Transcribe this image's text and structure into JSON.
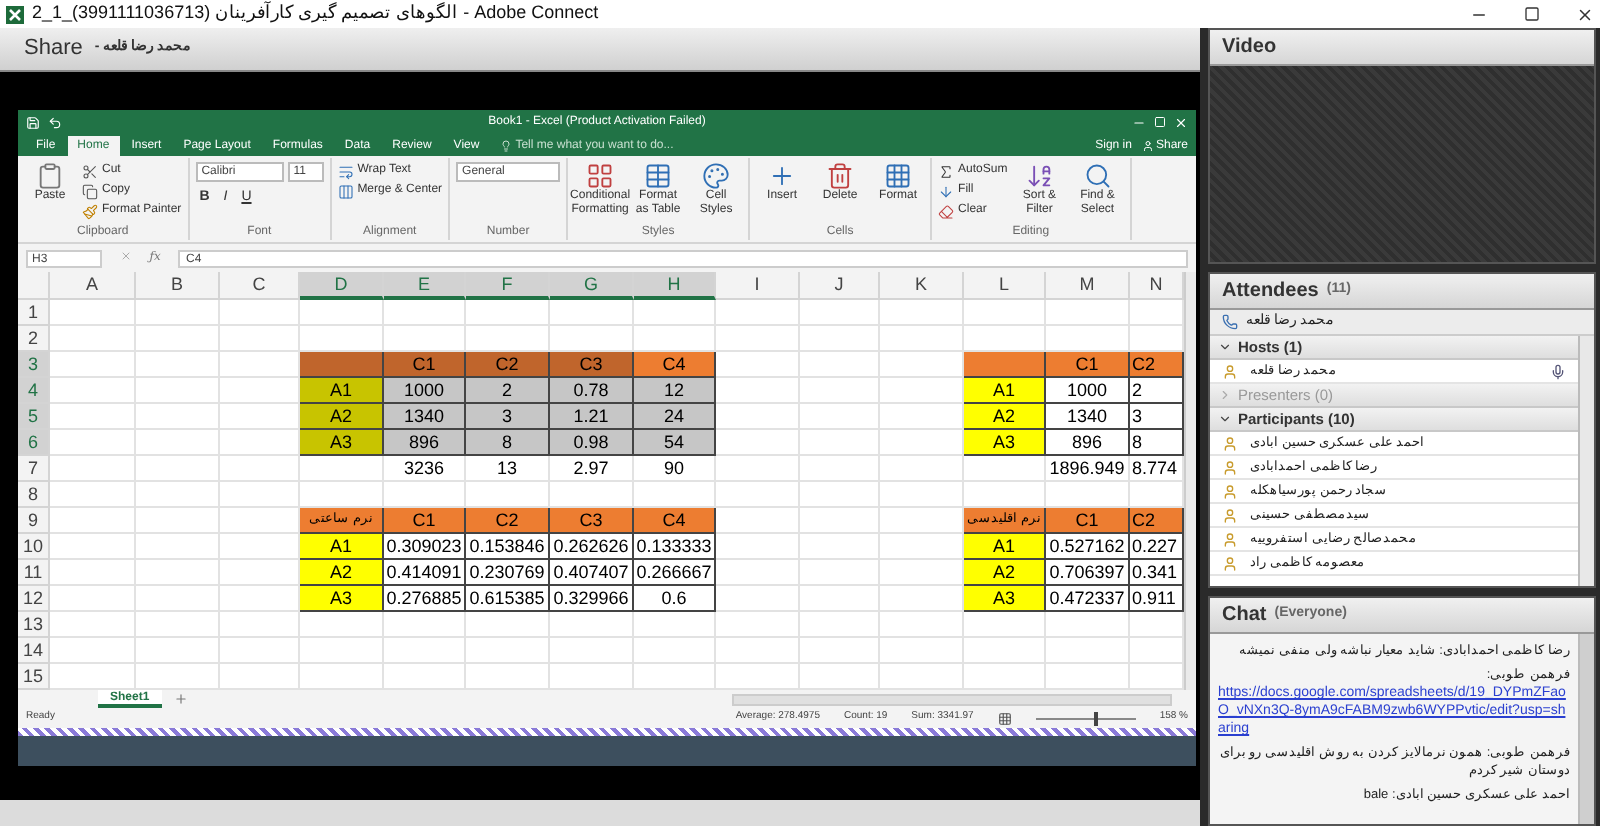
{
  "window": {
    "title": "2_1_(3991111036713) الگوهای تصمیم گیری کارآفرینان - Adobe Connect"
  },
  "share": {
    "title": "Share",
    "presenter": "- محمد رضا قلعه"
  },
  "excel": {
    "title": "Book1 - Excel (Product Activation Failed)",
    "sign_in": "Sign in",
    "share": "Share",
    "tell_me": "Tell me what you want to do...",
    "tabs": [
      {
        "label": "File",
        "selected": false
      },
      {
        "label": "Home",
        "selected": true
      },
      {
        "label": "Insert",
        "selected": false
      },
      {
        "label": "Page Layout",
        "selected": false
      },
      {
        "label": "Formulas",
        "selected": false
      },
      {
        "label": "Data",
        "selected": false
      },
      {
        "label": "Review",
        "selected": false
      },
      {
        "label": "View",
        "selected": false
      }
    ],
    "groups": [
      {
        "label": "Clipboard",
        "large": [
          {
            "kind": "paste",
            "label": "Paste"
          }
        ],
        "small": [
          {
            "kind": "cut",
            "label": "Cut"
          },
          {
            "kind": "copy",
            "label": "Copy"
          },
          {
            "kind": "painter",
            "label": "Format Painter"
          }
        ]
      },
      {
        "label": "Font",
        "font": "Calibri",
        "size": "11",
        "format": [
          "B",
          "I",
          "U"
        ]
      },
      {
        "label": "Alignment",
        "small": [
          {
            "kind": "wrap",
            "label": "Wrap Text"
          },
          {
            "kind": "merge",
            "label": "Merge & Center"
          }
        ]
      },
      {
        "label": "Number",
        "number_format": "General"
      },
      {
        "label": "Styles",
        "large": [
          {
            "kind": "conditional",
            "label": "Conditional Formatting"
          },
          {
            "kind": "table",
            "label": "Format as Table"
          },
          {
            "kind": "styles",
            "label": "Cell Styles"
          }
        ]
      },
      {
        "label": "Cells",
        "large": [
          {
            "kind": "insert",
            "label": "Insert"
          },
          {
            "kind": "delete",
            "label": "Delete"
          },
          {
            "kind": "format",
            "label": "Format"
          }
        ]
      },
      {
        "label": "Editing",
        "small": [
          {
            "kind": "sum",
            "label": "AutoSum"
          },
          {
            "kind": "fill",
            "label": "Fill"
          },
          {
            "kind": "clear",
            "label": "Clear"
          }
        ],
        "large": [
          {
            "kind": "sort",
            "label": "Sort & Filter"
          },
          {
            "kind": "find",
            "label": "Find & Select"
          }
        ]
      }
    ],
    "name_box": "H3",
    "function_label": "ƒx",
    "formula": "C4",
    "columns": [
      {
        "label": "A",
        "selected": false
      },
      {
        "label": "B",
        "selected": false
      },
      {
        "label": "C",
        "selected": false
      },
      {
        "label": "D",
        "selected": true
      },
      {
        "label": "E",
        "selected": true
      },
      {
        "label": "F",
        "selected": true
      },
      {
        "label": "G",
        "selected": true
      },
      {
        "label": "H",
        "selected": true
      },
      {
        "label": "I",
        "selected": false
      },
      {
        "label": "J",
        "selected": false
      },
      {
        "label": "K",
        "selected": false
      },
      {
        "label": "L",
        "selected": false
      },
      {
        "label": "M",
        "selected": false
      },
      {
        "label": "N",
        "selected": false
      }
    ],
    "rows": [
      {
        "number": "1",
        "selected": false
      },
      {
        "number": "2",
        "selected": false
      },
      {
        "number": "3",
        "selected": true,
        "cells": [
          {
            "selected": false
          },
          {
            "selected": false
          },
          {
            "selected": false
          },
          {
            "kind": "header",
            "selected": true
          },
          {
            "text": "C1",
            "kind": "header",
            "selected": true
          },
          {
            "text": "C2",
            "kind": "header",
            "selected": true
          },
          {
            "text": "C3",
            "kind": "header",
            "selected": true
          },
          {
            "text": "C4",
            "kind": "header",
            "selected": false
          },
          {
            "selected": false
          },
          {
            "selected": false
          },
          {
            "selected": false
          },
          {
            "kind": "header",
            "selected": false
          },
          {
            "text": "C1",
            "kind": "header",
            "selected": false
          },
          {
            "text": "C2",
            "kind": "header",
            "selected": false
          }
        ]
      },
      {
        "number": "4",
        "selected": true,
        "cells": [
          {
            "selected": false
          },
          {
            "selected": false
          },
          {
            "selected": false
          },
          {
            "text": "A1",
            "kind": "label",
            "selected": true
          },
          {
            "text": "1000",
            "kind": "value",
            "selected": true
          },
          {
            "text": "2",
            "kind": "value",
            "selected": true
          },
          {
            "text": "0.78",
            "kind": "value",
            "selected": true
          },
          {
            "text": "12",
            "kind": "value",
            "selected": true
          },
          {
            "selected": false
          },
          {
            "selected": false
          },
          {
            "selected": false
          },
          {
            "text": "A1",
            "kind": "label",
            "selected": false
          },
          {
            "text": "1000",
            "kind": "value",
            "selected": false
          },
          {
            "text": "2",
            "kind": "value",
            "selected": false
          }
        ]
      },
      {
        "number": "5",
        "selected": true,
        "cells": [
          {
            "selected": false
          },
          {
            "selected": false
          },
          {
            "selected": false
          },
          {
            "text": "A2",
            "kind": "label",
            "selected": true
          },
          {
            "text": "1340",
            "kind": "value",
            "selected": true
          },
          {
            "text": "3",
            "kind": "value",
            "selected": true
          },
          {
            "text": "1.21",
            "kind": "value",
            "selected": true
          },
          {
            "text": "24",
            "kind": "value",
            "selected": true
          },
          {
            "selected": false
          },
          {
            "selected": false
          },
          {
            "selected": false
          },
          {
            "text": "A2",
            "kind": "label",
            "selected": false
          },
          {
            "text": "1340",
            "kind": "value",
            "selected": false
          },
          {
            "text": "3",
            "kind": "value",
            "selected": false
          }
        ]
      },
      {
        "number": "6",
        "selected": true,
        "cells": [
          {
            "selected": false
          },
          {
            "selected": false
          },
          {
            "selected": false
          },
          {
            "text": "A3",
            "kind": "label",
            "selected": true
          },
          {
            "text": "896",
            "kind": "value",
            "selected": true
          },
          {
            "text": "8",
            "kind": "value",
            "selected": true
          },
          {
            "text": "0.98",
            "kind": "value",
            "selected": true
          },
          {
            "text": "54",
            "kind": "value",
            "selected": true
          },
          {
            "selected": false
          },
          {
            "selected": false
          },
          {
            "selected": false
          },
          {
            "text": "A3",
            "kind": "label",
            "selected": false
          },
          {
            "text": "896",
            "kind": "value",
            "selected": false
          },
          {
            "text": "8",
            "kind": "value",
            "selected": false
          }
        ]
      },
      {
        "number": "7",
        "selected": false,
        "cells": [
          {
            "selected": false
          },
          {
            "selected": false
          },
          {
            "selected": false
          },
          {
            "selected": false
          },
          {
            "text": "3236",
            "selected": false
          },
          {
            "text": "13",
            "selected": false
          },
          {
            "text": "2.97",
            "selected": false
          },
          {
            "text": "90",
            "selected": false
          },
          {
            "selected": false
          },
          {
            "selected": false
          },
          {
            "selected": false
          },
          {
            "selected": false
          },
          {
            "text": "1896.949",
            "selected": false
          },
          {
            "text": "8.774",
            "selected": false
          }
        ]
      },
      {
        "number": "8",
        "selected": false
      },
      {
        "number": "9",
        "selected": false,
        "cells": [
          {
            "selected": false
          },
          {
            "selected": false
          },
          {
            "selected": false
          },
          {
            "text": "نرم ساعتی",
            "kind": "header",
            "selected": false
          },
          {
            "text": "C1",
            "kind": "header",
            "selected": false
          },
          {
            "text": "C2",
            "kind": "header",
            "selected": false
          },
          {
            "text": "C3",
            "kind": "header",
            "selected": false
          },
          {
            "text": "C4",
            "kind": "header",
            "selected": false
          },
          {
            "selected": false
          },
          {
            "selected": false
          },
          {
            "selected": false
          },
          {
            "text": "نرم اقلیدسی",
            "kind": "header",
            "selected": false
          },
          {
            "text": "C1",
            "kind": "header",
            "selected": false
          },
          {
            "text": "C2",
            "kind": "header",
            "selected": false
          }
        ]
      },
      {
        "number": "10",
        "selected": false,
        "cells": [
          {
            "selected": false
          },
          {
            "selected": false
          },
          {
            "selected": false
          },
          {
            "text": "A1",
            "kind": "label",
            "selected": false
          },
          {
            "text": "0.309023",
            "kind": "value",
            "selected": false
          },
          {
            "text": "0.153846",
            "kind": "value",
            "selected": false
          },
          {
            "text": "0.262626",
            "kind": "value",
            "selected": false
          },
          {
            "text": "0.133333",
            "kind": "value",
            "selected": false
          },
          {
            "selected": false
          },
          {
            "selected": false
          },
          {
            "selected": false
          },
          {
            "text": "A1",
            "kind": "label",
            "selected": false
          },
          {
            "text": "0.527162",
            "kind": "value",
            "selected": false
          },
          {
            "text": "0.227",
            "kind": "value",
            "selected": false
          }
        ]
      },
      {
        "number": "11",
        "selected": false,
        "cells": [
          {
            "selected": false
          },
          {
            "selected": false
          },
          {
            "selected": false
          },
          {
            "text": "A2",
            "kind": "label",
            "selected": false
          },
          {
            "text": "0.414091",
            "kind": "value",
            "selected": false
          },
          {
            "text": "0.230769",
            "kind": "value",
            "selected": false
          },
          {
            "text": "0.407407",
            "kind": "value",
            "selected": false
          },
          {
            "text": "0.266667",
            "kind": "value",
            "selected": false
          },
          {
            "selected": false
          },
          {
            "selected": false
          },
          {
            "selected": false
          },
          {
            "text": "A2",
            "kind": "label",
            "selected": false
          },
          {
            "text": "0.706397",
            "kind": "value",
            "selected": false
          },
          {
            "text": "0.341",
            "kind": "value",
            "selected": false
          }
        ]
      },
      {
        "number": "12",
        "selected": false,
        "cells": [
          {
            "selected": false
          },
          {
            "selected": false
          },
          {
            "selected": false
          },
          {
            "text": "A3",
            "kind": "label",
            "selected": false
          },
          {
            "text": "0.276885",
            "kind": "value",
            "selected": false
          },
          {
            "text": "0.615385",
            "kind": "value",
            "selected": false
          },
          {
            "text": "0.329966",
            "kind": "value",
            "selected": false
          },
          {
            "text": "0.6",
            "kind": "value",
            "selected": false
          },
          {
            "selected": false
          },
          {
            "selected": false
          },
          {
            "selected": false
          },
          {
            "text": "A3",
            "kind": "label",
            "selected": false
          },
          {
            "text": "0.472337",
            "kind": "value",
            "selected": false
          },
          {
            "text": "0.911",
            "kind": "value",
            "selected": false
          }
        ]
      },
      {
        "number": "13",
        "selected": false
      },
      {
        "number": "14",
        "selected": false
      },
      {
        "number": "15",
        "selected": false
      }
    ],
    "sheets": [
      {
        "label": "Sheet1",
        "selected": true
      }
    ],
    "status": {
      "state": "Ready",
      "average": "Average: 278.4975",
      "count": "Count: 19",
      "sum": "Sum: 3341.97",
      "zoom": "158 %",
      "zoom_slider": {
        "level": 0.6
      }
    }
  },
  "video": {
    "title": "Video"
  },
  "attendees": {
    "title": "Attendees",
    "count": "(11)",
    "speaker": "محمد رضا قلعه",
    "sections": [
      {
        "label": "Hosts (1)",
        "expanded": true,
        "people": [
          {
            "name": "محمد رضا قلعه",
            "mic": true
          }
        ]
      },
      {
        "label": "Presenters (0)",
        "expanded": false
      },
      {
        "label": "Participants (10)",
        "expanded": true,
        "people": [
          {
            "name": "احمد علی عسکری حسین ابادی",
            "mic": false
          },
          {
            "name": "رضا کاظمی احمدابادی",
            "mic": false
          },
          {
            "name": "سجاد رحمن پورسیاهکله",
            "mic": false
          },
          {
            "name": "سیدمصطفی حسینی",
            "mic": false
          },
          {
            "name": "محمدصالح رضایی استفروییه",
            "mic": false
          },
          {
            "name": "معصومه کاظمی راد",
            "mic": false
          }
        ]
      }
    ]
  },
  "chat": {
    "title": "Chat",
    "scope": "(Everyone)",
    "messages": [
      {
        "text": "رضا کاظمی احمدابادی: شاید معیار نباشه ولی منفی نمیشه"
      },
      {
        "text": "فرهمن طوبی:",
        "link": "https://docs.google.com/spreadsheets/d/19_DYPmZFaoO_vNXn3Q-8ymA9cFABM9zwb6WYPPvtic/edit?usp=sharing"
      },
      {
        "text": "فرهمن طوبی: همون نرمالایز کردن به روش اقلیدسی رو برای دوستان شیر کردم"
      },
      {
        "text": "احمد علی عسکری حسین ابادی: bale"
      }
    ]
  }
}
